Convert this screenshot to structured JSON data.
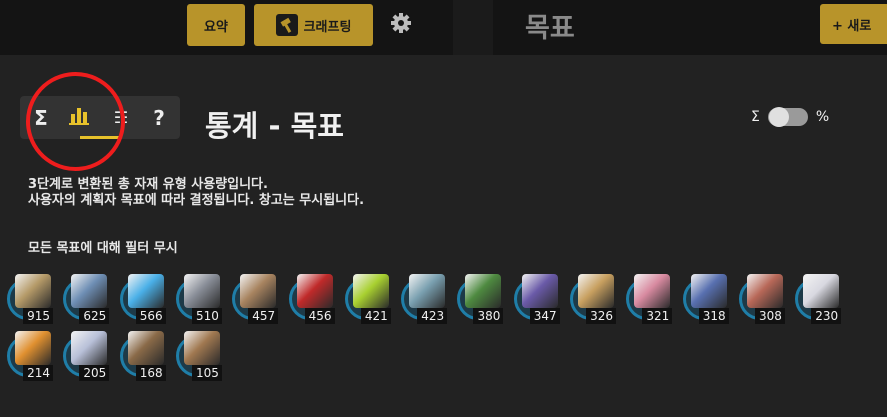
{
  "header": {
    "summary_label": "요약",
    "craft_label": "크래프팅",
    "settings_icon": "gear-icon",
    "goal_title": "목표",
    "new_label": "+ 새로"
  },
  "tabs": [
    {
      "icon": "sigma-icon",
      "glyph": "Σ",
      "active": false
    },
    {
      "icon": "bar-chart-icon",
      "glyph": "",
      "active": true
    },
    {
      "icon": "list-icon",
      "glyph": "☷",
      "active": false
    },
    {
      "icon": "help-icon",
      "glyph": "?",
      "active": false
    }
  ],
  "page_title": "통계 - 목표",
  "toggle": {
    "left_label": "Σ",
    "right_label": "%",
    "on": false
  },
  "description": {
    "line1": "3단계로 변환된 총 자재 유형 사용량입니다.",
    "line2": "사용자의 계획자 목표에 따라 결정됩니다. 창고는 무시됩니다."
  },
  "filter_note": "모든 목표에 대해 필터 무시",
  "colors": {
    "accent": "#b8942a",
    "annotation": "#ee1d1d",
    "ring": "#1f7ea8"
  },
  "materials": [
    {
      "count": "915",
      "color": "#b59a68"
    },
    {
      "count": "625",
      "color": "#6f8fb5"
    },
    {
      "count": "566",
      "color": "#4ab0e8"
    },
    {
      "count": "510",
      "color": "#8a8f99"
    },
    {
      "count": "457",
      "color": "#a88460"
    },
    {
      "count": "456",
      "color": "#c02a2a"
    },
    {
      "count": "421",
      "color": "#a8d030"
    },
    {
      "count": "423",
      "color": "#7aa0b0"
    },
    {
      "count": "380",
      "color": "#4e8a40"
    },
    {
      "count": "347",
      "color": "#6a5aa8"
    },
    {
      "count": "326",
      "color": "#c8a060"
    },
    {
      "count": "321",
      "color": "#d88aa0"
    },
    {
      "count": "318",
      "color": "#5870b0"
    },
    {
      "count": "308",
      "color": "#b86858"
    },
    {
      "count": "230",
      "color": "#d8d8e0"
    },
    {
      "count": "214",
      "color": "#e09030"
    },
    {
      "count": "205",
      "color": "#b8c0d8"
    },
    {
      "count": "168",
      "color": "#8a6a48"
    },
    {
      "count": "105",
      "color": "#a07850"
    }
  ]
}
